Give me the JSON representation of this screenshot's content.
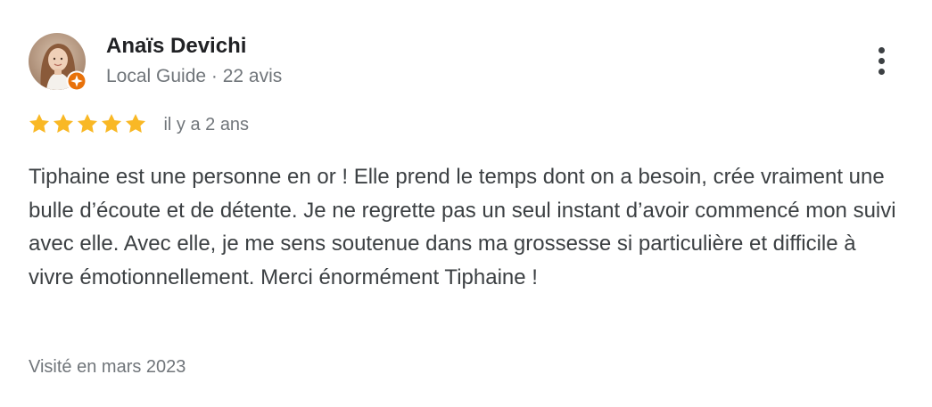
{
  "author": {
    "name": "Anaïs Devichi",
    "meta": "Local Guide · 22 avis"
  },
  "review": {
    "rating": 5,
    "rating_max": 5,
    "date": "il y a 2 ans",
    "text": "Tiphaine est une personne en or ! Elle prend le temps dont on a besoin, crée vraiment une bulle d’écoute et de détente. Je ne regrette pas un seul instant d’avoir commencé mon suivi avec elle. Avec elle, je me sens soutenue dans ma grossesse si particulière et difficile à vivre émotionnellement. Merci énormément Tiphaine !",
    "visited": "Visité en mars 2023"
  },
  "icons": {
    "avatar": "avatar-photo",
    "badge": "local-guide-badge-icon",
    "star": "star-icon",
    "more": "more-vert-icon"
  },
  "colors": {
    "star": "#f9b825",
    "badge": "#e8710a",
    "name": "#202124",
    "secondary": "#70757a",
    "body_text": "#3c4043"
  }
}
